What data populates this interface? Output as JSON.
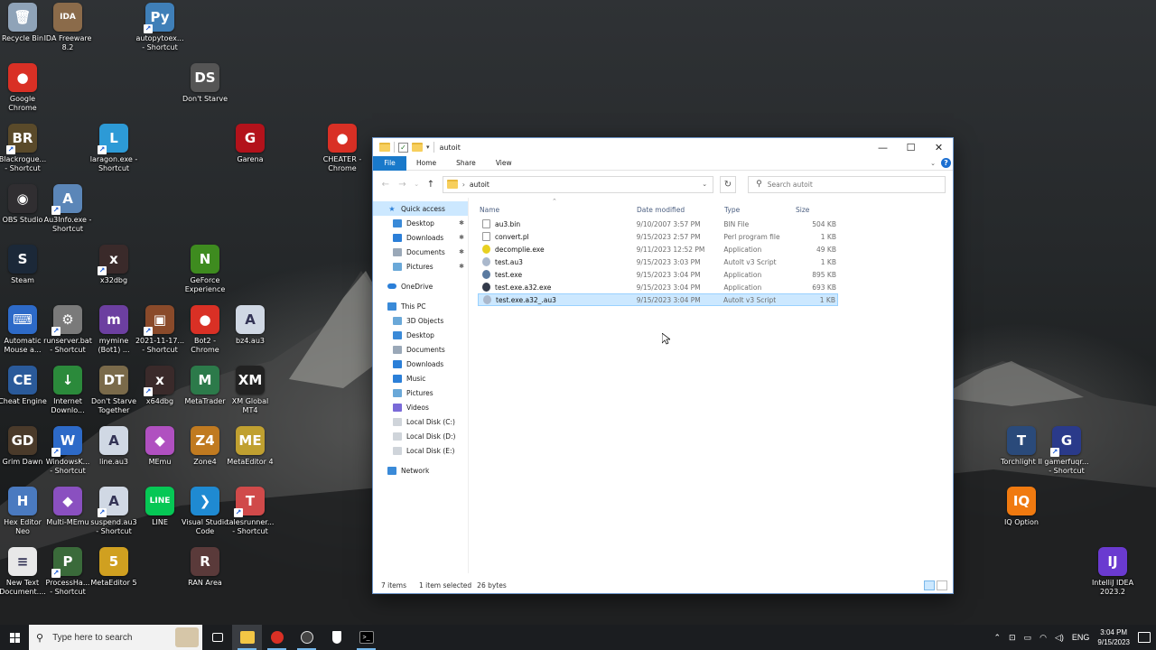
{
  "desktop": {
    "icons": [
      {
        "label": "Recycle Bin",
        "glyph": "🗑",
        "color": "#8fa3b8",
        "shortcut": false
      },
      {
        "label": "IDA Freeware\n8.2",
        "glyph": "IDA",
        "color": "#8b6b4a",
        "shortcut": false
      },
      {
        "label": "autopytoex...\n- Shortcut",
        "glyph": "Py",
        "color": "#3f7fb8",
        "shortcut": true
      },
      {
        "label": "Google\nChrome",
        "glyph": "●",
        "color": "#d93025",
        "shortcut": false
      },
      {
        "label": "Don't Starve",
        "glyph": "DS",
        "color": "#555",
        "shortcut": false
      },
      {
        "label": "Blackrogue...\n- Shortcut",
        "glyph": "BR",
        "color": "#5a4a2a",
        "shortcut": true
      },
      {
        "label": "laragon.exe -\nShortcut",
        "glyph": "L",
        "color": "#2d9ad6",
        "shortcut": true
      },
      {
        "label": "Garena",
        "glyph": "G",
        "color": "#b3121b",
        "shortcut": false
      },
      {
        "label": "CHEATER -\nChrome",
        "glyph": "●",
        "color": "#d93025",
        "shortcut": false
      },
      {
        "label": "OBS Studio",
        "glyph": "◉",
        "color": "#302e31",
        "shortcut": false
      },
      {
        "label": "Au3Info.exe -\nShortcut",
        "glyph": "A",
        "color": "#5b86b8",
        "shortcut": true
      },
      {
        "label": "Steam",
        "glyph": "S",
        "color": "#1b2838",
        "shortcut": false
      },
      {
        "label": "x32dbg",
        "glyph": "x",
        "color": "#3a2a2a",
        "shortcut": true
      },
      {
        "label": "GeForce\nExperience",
        "glyph": "N",
        "color": "#3e8b1f",
        "shortcut": false
      },
      {
        "label": "Automatic\nMouse a...",
        "glyph": "⌨",
        "color": "#2d6ac8",
        "shortcut": false
      },
      {
        "label": "runserver.bat\n- Shortcut",
        "glyph": "⚙",
        "color": "#7a7a7a",
        "shortcut": true
      },
      {
        "label": "mymine\n(Bot1) ...",
        "glyph": "m",
        "color": "#6c3fa0",
        "shortcut": false
      },
      {
        "label": "2021-11-17...\n- Shortcut",
        "glyph": "▣",
        "color": "#8a4a2a",
        "shortcut": true
      },
      {
        "label": "Bot2 -\nChrome",
        "glyph": "●",
        "color": "#d93025",
        "shortcut": false
      },
      {
        "label": "bz4.au3",
        "glyph": "A",
        "color": "#d0d8e4",
        "shortcut": false
      },
      {
        "label": "Cheat Engine",
        "glyph": "CE",
        "color": "#2a5a9a",
        "shortcut": false
      },
      {
        "label": "Internet\nDownlo...",
        "glyph": "↓",
        "color": "#2b8a3b",
        "shortcut": false
      },
      {
        "label": "Don't Starve\nTogether",
        "glyph": "DT",
        "color": "#7a6a4a",
        "shortcut": false
      },
      {
        "label": "x64dbg",
        "glyph": "x",
        "color": "#3a2a2a",
        "shortcut": true
      },
      {
        "label": "MetaTrader",
        "glyph": "M",
        "color": "#2c7a4a",
        "shortcut": false
      },
      {
        "label": "XM Global\nMT4",
        "glyph": "XM",
        "color": "#222",
        "shortcut": false
      },
      {
        "label": "Grim Dawn",
        "glyph": "GD",
        "color": "#4a3a2a",
        "shortcut": false
      },
      {
        "label": "WindowsK...\n- Shortcut",
        "glyph": "W",
        "color": "#2d6ac8",
        "shortcut": true
      },
      {
        "label": "line.au3",
        "glyph": "A",
        "color": "#d0d8e4",
        "shortcut": false
      },
      {
        "label": "MEmu",
        "glyph": "◆",
        "color": "#b050c0",
        "shortcut": false
      },
      {
        "label": "Zone4",
        "glyph": "Z4",
        "color": "#c07a20",
        "shortcut": false
      },
      {
        "label": "MetaEditor 4",
        "glyph": "ME",
        "color": "#c0a030",
        "shortcut": false
      },
      {
        "label": "Hex Editor\nNeo",
        "glyph": "H",
        "color": "#4a7ac0",
        "shortcut": false
      },
      {
        "label": "Multi-MEmu",
        "glyph": "◆",
        "color": "#8a50c0",
        "shortcut": false
      },
      {
        "label": "suspend.au3\n- Shortcut",
        "glyph": "A",
        "color": "#d0d8e4",
        "shortcut": true
      },
      {
        "label": "LINE",
        "glyph": "LINE",
        "color": "#06c755",
        "shortcut": false
      },
      {
        "label": "Visual Studio\nCode",
        "glyph": "❯",
        "color": "#1f8ad2",
        "shortcut": false
      },
      {
        "label": "talesrunner...\n- Shortcut",
        "glyph": "T",
        "color": "#d04a4a",
        "shortcut": true
      },
      {
        "label": "New Text\nDocument....",
        "glyph": "≡",
        "color": "#e8e8e8",
        "shortcut": false
      },
      {
        "label": "ProcessHa...\n- Shortcut",
        "glyph": "P",
        "color": "#3a6a3a",
        "shortcut": true
      },
      {
        "label": "MetaEditor 5",
        "glyph": "5",
        "color": "#d0a020",
        "shortcut": false
      },
      {
        "label": "RAN Area",
        "glyph": "R",
        "color": "#5a3a3a",
        "shortcut": false
      },
      {
        "label": "Torchlight II",
        "glyph": "T",
        "color": "#2a4a7a",
        "shortcut": false
      },
      {
        "label": "gamerfuqr...\n- Shortcut",
        "glyph": "G",
        "color": "#2a3a8a",
        "shortcut": true
      },
      {
        "label": "IQ Option",
        "glyph": "IQ",
        "color": "#f07a10",
        "shortcut": false
      },
      {
        "label": "IntelliJ IDEA\n2023.2",
        "glyph": "IJ",
        "color": "#6a3ad0",
        "shortcut": false
      }
    ]
  },
  "explorer": {
    "title": "autoit",
    "window_buttons": {
      "minimize": "—",
      "maximize": "☐",
      "close": "✕"
    },
    "ribbon_tabs": [
      "File",
      "Home",
      "Share",
      "View"
    ],
    "help": "?",
    "address": {
      "path": "autoit",
      "back": "←",
      "forward": "→",
      "recent": "⌄",
      "up": "↑",
      "refresh": "↻"
    },
    "search_placeholder": "Search autoit",
    "nav": {
      "quick_access": "Quick access",
      "quick_items": [
        "Desktop",
        "Downloads",
        "Documents",
        "Pictures"
      ],
      "onedrive": "OneDrive",
      "this_pc": "This PC",
      "pc_items": [
        "3D Objects",
        "Desktop",
        "Documents",
        "Downloads",
        "Music",
        "Pictures",
        "Videos",
        "Local Disk (C:)",
        "Local Disk (D:)",
        "Local Disk (E:)"
      ],
      "network": "Network"
    },
    "columns": {
      "name": "Name",
      "date": "Date modified",
      "type": "Type",
      "size": "Size"
    },
    "files": [
      {
        "name": "au3.bin",
        "date": "9/10/2007 3:57 PM",
        "type": "BIN File",
        "size": "504 KB",
        "icon": "#ffffff"
      },
      {
        "name": "convert.pl",
        "date": "9/15/2023 2:57 PM",
        "type": "Perl program file",
        "size": "1 KB",
        "icon": "#ffffff"
      },
      {
        "name": "decomplie.exe",
        "date": "9/11/2023 12:52 PM",
        "type": "Application",
        "size": "49 KB",
        "icon": "#e8d020"
      },
      {
        "name": "test.au3",
        "date": "9/15/2023 3:03 PM",
        "type": "AutoIt v3 Script",
        "size": "1 KB",
        "icon": "#aab8cc"
      },
      {
        "name": "test.exe",
        "date": "9/15/2023 3:04 PM",
        "type": "Application",
        "size": "895 KB",
        "icon": "#5a7aa0"
      },
      {
        "name": "test.exe.a32.exe",
        "date": "9/15/2023 3:04 PM",
        "type": "Application",
        "size": "693 KB",
        "icon": "#333a4a"
      },
      {
        "name": "test.exe.a32_.au3",
        "date": "9/15/2023 3:04 PM",
        "type": "AutoIt v3 Script",
        "size": "1 KB",
        "icon": "#aab8cc"
      }
    ],
    "selected_index": 6,
    "status": {
      "items": "7 items",
      "selected": "1 item selected",
      "bytes": "26 bytes"
    }
  },
  "taskbar": {
    "search_placeholder": "Type here to search",
    "apps": [
      "task-view",
      "file-explorer",
      "chrome",
      "cheat-engine",
      "shield",
      "terminal"
    ],
    "lang": "ENG",
    "time": "3:04 PM",
    "date": "9/15/2023"
  }
}
